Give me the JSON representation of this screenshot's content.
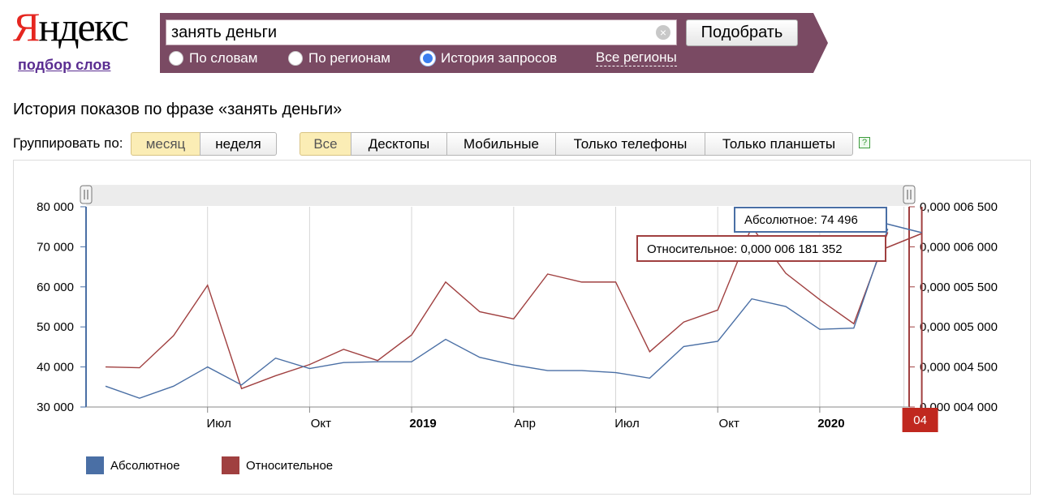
{
  "logo": {
    "first": "Я",
    "rest": "ндекс"
  },
  "sublink": "подбор слов",
  "search": {
    "value": "занять деньги",
    "button": "Подобрать"
  },
  "radios": [
    "По словам",
    "По регионам",
    "История запросов"
  ],
  "regions_link": "Все регионы",
  "page_title": "История показов по фразе «занять деньги»",
  "group_label": "Группировать по:",
  "group_buttons": [
    "месяц",
    "неделя"
  ],
  "device_buttons": [
    "Все",
    "Десктопы",
    "Мобильные",
    "Только телефоны",
    "Только планшеты"
  ],
  "help": "?",
  "colors": {
    "abs": "#4a6fa5",
    "rel": "#a04040",
    "bar": "#7a4a63",
    "active": "#fbedb5"
  },
  "chart_data": {
    "type": "line",
    "x": [
      "2018-04",
      "2018-05",
      "2018-06",
      "2018-07",
      "2018-08",
      "2018-09",
      "2018-10",
      "2018-11",
      "2018-12",
      "2019-01",
      "2019-02",
      "2019-03",
      "2019-04",
      "2019-05",
      "2019-06",
      "2019-07",
      "2019-08",
      "2019-09",
      "2019-10",
      "2019-11",
      "2019-12",
      "2020-01",
      "2020-02",
      "2020-03",
      "2020-04"
    ],
    "x_tick_labels": [
      "Июл",
      "Окт",
      "2019",
      "Апр",
      "Июл",
      "Окт",
      "2020"
    ],
    "x_tick_positions": [
      "2018-07",
      "2018-10",
      "2019-01",
      "2019-04",
      "2019-07",
      "2019-10",
      "2020-01"
    ],
    "x_tick_bold": [
      false,
      false,
      true,
      false,
      false,
      false,
      true
    ],
    "series": [
      {
        "name": "Абсолютное",
        "axis": "left",
        "values": [
          35200,
          32200,
          35200,
          40000,
          35500,
          42200,
          39600,
          41100,
          41300,
          41300,
          46900,
          42400,
          40500,
          39100,
          39100,
          38600,
          37200,
          45100,
          46400,
          57000,
          55100,
          49400,
          49700,
          74496
        ]
      },
      {
        "name": "Относительное",
        "axis": "right",
        "values": [
          4.5e-06,
          4.49e-06,
          4.89e-06,
          5.52e-06,
          4.23e-06,
          4.39e-06,
          4.53e-06,
          4.72e-06,
          4.58e-06,
          4.9e-06,
          5.56e-06,
          5.19e-06,
          5.1e-06,
          5.66e-06,
          5.56e-06,
          5.56e-06,
          4.69e-06,
          5.06e-06,
          5.21e-06,
          6.25e-06,
          5.67e-06,
          5.34e-06,
          5.04e-06,
          6.181352e-06
        ]
      }
    ],
    "left_axis": {
      "ylim": [
        30000,
        80000
      ],
      "ticks": [
        "30 000",
        "40 000",
        "50 000",
        "60 000",
        "70 000",
        "80 000"
      ]
    },
    "right_axis": {
      "ylim": [
        4e-06,
        6.5e-06
      ],
      "ticks": [
        "0,000 004 000",
        "0,000 004 500",
        "0,000 005 000",
        "0,000 005 500",
        "0,000 006 000",
        "0,000 006 500"
      ]
    },
    "tooltip": {
      "abs": "Абсолютное: 74 496",
      "rel": "Относительное: 0,000 006 181 352"
    },
    "marker_label": "04",
    "legend": [
      "Абсолютное",
      "Относительное"
    ]
  }
}
